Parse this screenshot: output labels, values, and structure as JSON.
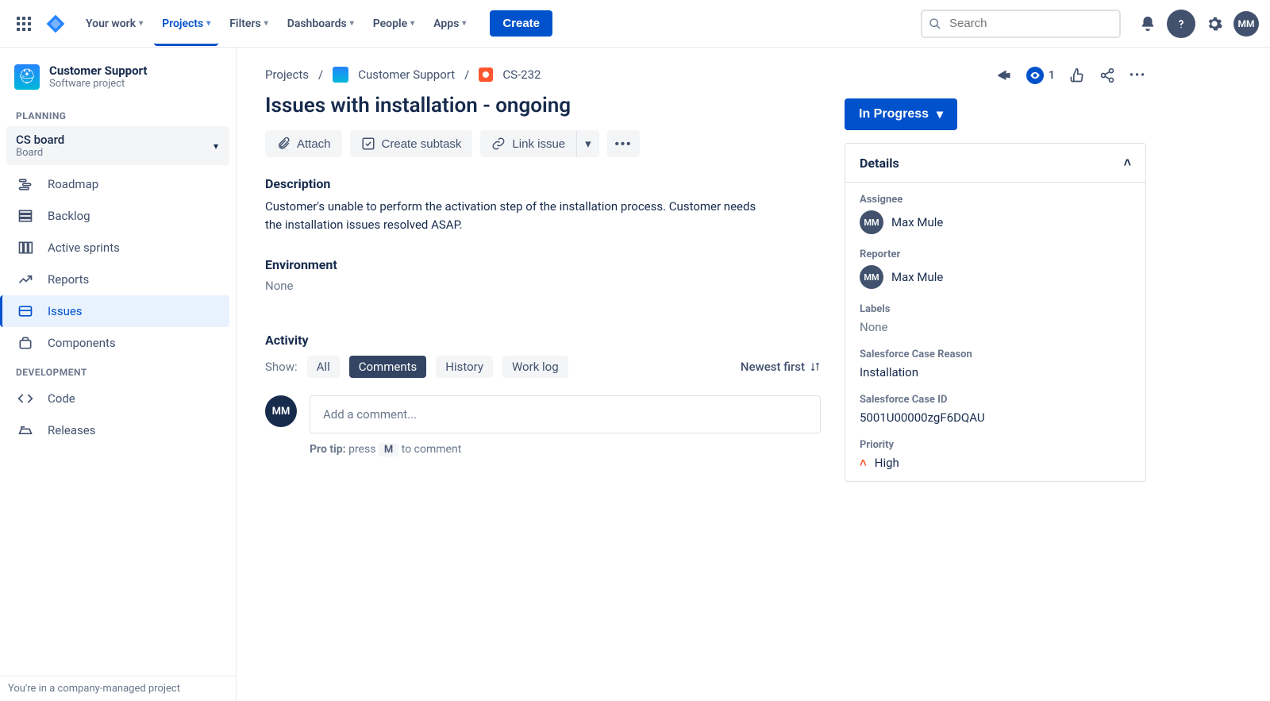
{
  "topnav": {
    "items": [
      "Your work",
      "Projects",
      "Filters",
      "Dashboards",
      "People",
      "Apps"
    ],
    "create": "Create",
    "search_placeholder": "Search",
    "avatar": "MM"
  },
  "sidebar": {
    "project_name": "Customer Support",
    "project_type": "Software project",
    "section_planning": "PLANNING",
    "board_name": "CS board",
    "board_sub": "Board",
    "items_planning": [
      "Roadmap",
      "Backlog",
      "Active sprints",
      "Reports",
      "Issues",
      "Components"
    ],
    "section_dev": "DEVELOPMENT",
    "items_dev": [
      "Code",
      "Releases"
    ],
    "footer": "You're in a company-managed project"
  },
  "breadcrumbs": {
    "root": "Projects",
    "project": "Customer Support",
    "key": "CS-232"
  },
  "issue": {
    "title": "Issues with installation - ongoing",
    "actions": {
      "attach": "Attach",
      "subtask": "Create subtask",
      "link": "Link issue"
    },
    "description_label": "Description",
    "description": "Customer's unable to perform the activation step of the installation process. Customer needs the installation issues resolved ASAP.",
    "environment_label": "Environment",
    "environment": "None",
    "activity_label": "Activity",
    "show_label": "Show:",
    "tabs": [
      "All",
      "Comments",
      "History",
      "Work log"
    ],
    "sort": "Newest first",
    "comment_placeholder": "Add a comment...",
    "protip_bold": "Pro tip:",
    "protip_press": "press",
    "protip_key": "M",
    "protip_rest": "to comment",
    "avatar": "MM"
  },
  "right": {
    "watchers": "1",
    "status": "In Progress",
    "details_header": "Details",
    "assignee_label": "Assignee",
    "assignee": "Max Mule",
    "reporter_label": "Reporter",
    "reporter": "Max Mule",
    "labels_label": "Labels",
    "labels": "None",
    "sf_reason_label": "Salesforce Case Reason",
    "sf_reason": "Installation",
    "sf_id_label": "Salesforce Case ID",
    "sf_id": "5001U00000zgF6DQAU",
    "priority_label": "Priority",
    "priority": "High",
    "avatar": "MM"
  }
}
